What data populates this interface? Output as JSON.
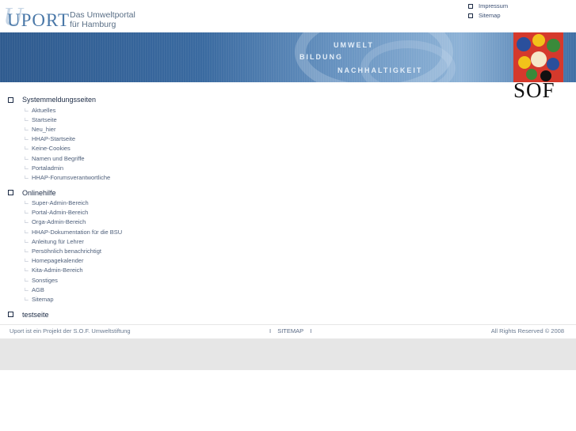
{
  "logo": {
    "word": "UPORT",
    "script": "U",
    "tagline_1": "Das Umweltportal",
    "tagline_2": "für Hamburg"
  },
  "top_links": [
    {
      "label": "Impressum"
    },
    {
      "label": "Sitemap"
    }
  ],
  "banner": {
    "words": [
      "UMWELT",
      "BILDUNG",
      "NACHHALTIGKEIT"
    ]
  },
  "sof_logo": {
    "text": "SOF"
  },
  "groups": [
    {
      "title": "Systemmeldungsseiten",
      "items": [
        "Aktuelles",
        "Startseite",
        "Neu_hier",
        "HHAP-Startseite",
        "Keine-Cookies",
        "Namen und Begriffe",
        "Portaladmin",
        "HHAP-Forumsverantwortliche"
      ]
    },
    {
      "title": "Onlinehilfe",
      "items": [
        "Super-Admin-Bereich",
        "Portal-Admin-Bereich",
        "Orga-Admin-Bereich",
        "HHAP-Dokumentation für die BSU",
        "Anleitung für Lehrer",
        "Persöhnlich benachrichtigt",
        "Homepagekalender",
        "Kita-Admin-Bereich",
        "Sonstiges",
        "AGB",
        "Sitemap"
      ]
    },
    {
      "title": "testseite",
      "items": []
    }
  ],
  "footer": {
    "left": "Uport ist ein Projekt der S.O.F. Umweltstiftung",
    "mid_sep": "I",
    "mid_link": "SITEMAP",
    "right": "All Rights Reserved © 2008"
  },
  "colors": {
    "banner": "#3a6aa0",
    "text": "#1b2a44",
    "grey_band": "#e6e6e6"
  }
}
